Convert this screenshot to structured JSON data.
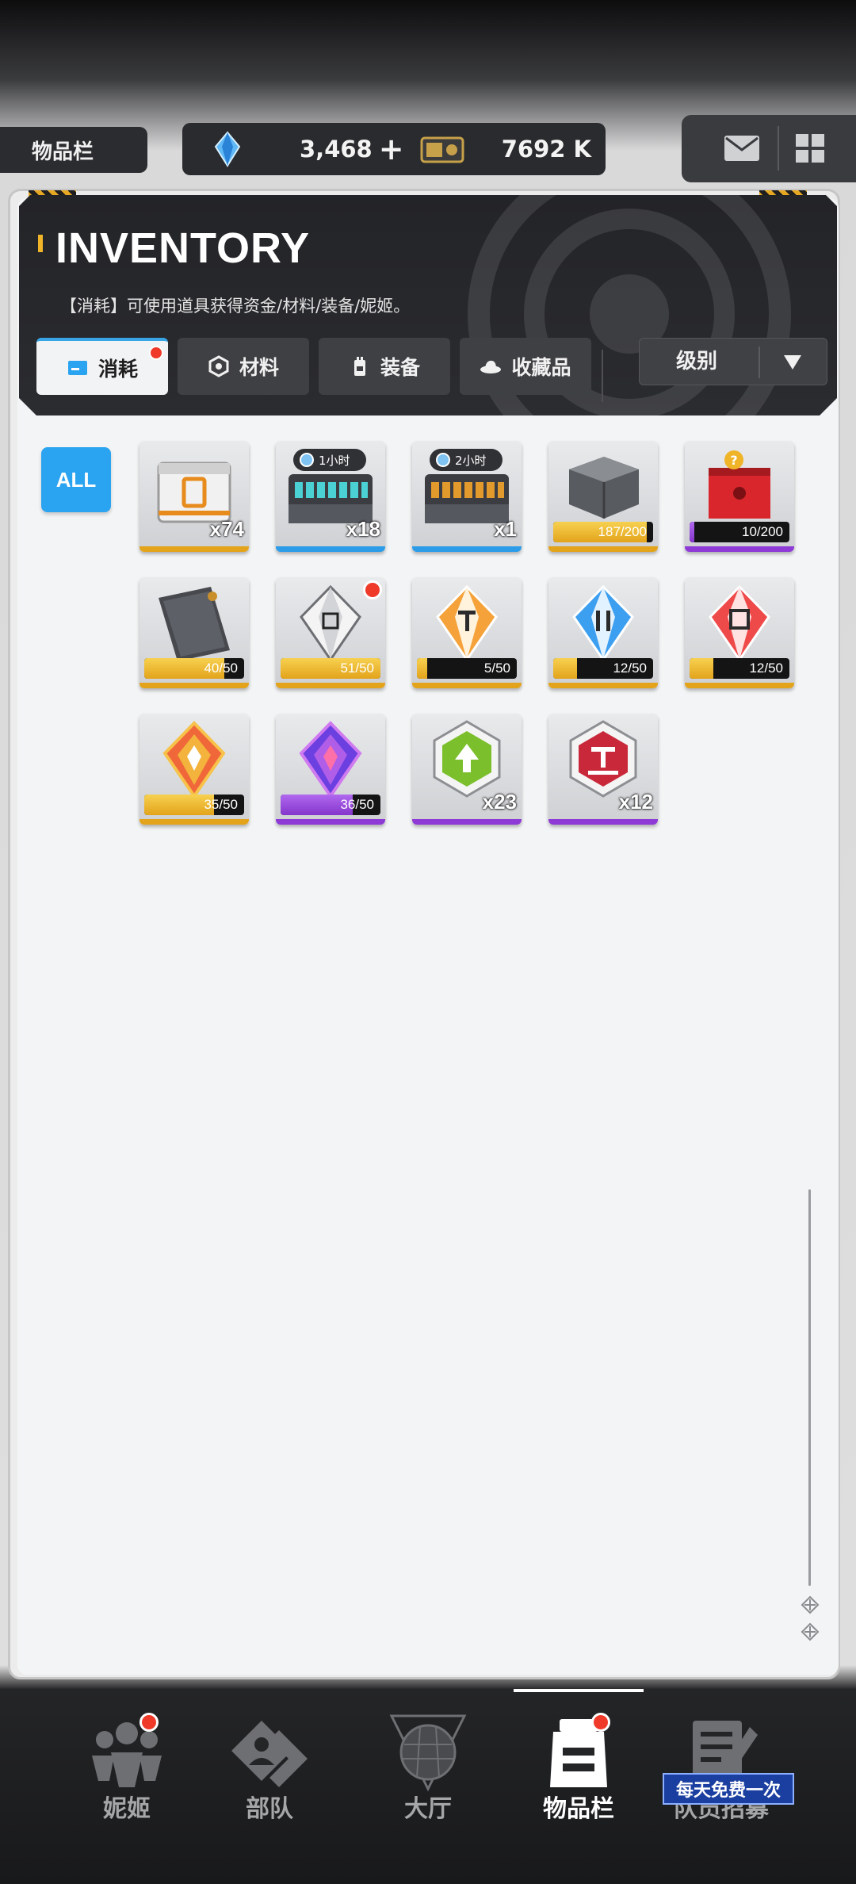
{
  "header": {
    "screen_label": "物品栏",
    "currency": {
      "gems": "3,468",
      "credits": "7692 K"
    }
  },
  "panel": {
    "title": "INVENTORY",
    "description": "【消耗】可使用道具获得资金/材料/装备/妮姬。",
    "tabs": [
      {
        "label": "消耗",
        "active": true,
        "badge": true
      },
      {
        "label": "材料",
        "active": false,
        "badge": false
      },
      {
        "label": "装备",
        "active": false,
        "badge": false
      },
      {
        "label": "收藏品",
        "active": false,
        "badge": false
      }
    ],
    "sort": {
      "selected": "级别"
    }
  },
  "filter": {
    "all_label": "ALL"
  },
  "items": [
    {
      "count": "x74",
      "rarity": "gold"
    },
    {
      "count": "x18",
      "tag": "1小时",
      "rarity": "blue"
    },
    {
      "count": "x1",
      "tag": "2小时",
      "rarity": "blue"
    },
    {
      "progress_text": "187/200",
      "progress": 0.935,
      "rarity": "gold"
    },
    {
      "progress_text": "10/200",
      "progress": 0.05,
      "rarity": "purple"
    },
    {
      "progress_text": "40/50",
      "progress": 0.8,
      "rarity": "gold"
    },
    {
      "progress_text": "51/50",
      "progress": 1.0,
      "rarity": "gold",
      "badge": true
    },
    {
      "progress_text": "5/50",
      "progress": 0.1,
      "rarity": "gold"
    },
    {
      "progress_text": "12/50",
      "progress": 0.24,
      "rarity": "gold"
    },
    {
      "progress_text": "12/50",
      "progress": 0.24,
      "rarity": "gold"
    },
    {
      "progress_text": "35/50",
      "progress": 0.7,
      "rarity": "gold"
    },
    {
      "progress_text": "36/50",
      "progress": 0.72,
      "rarity": "purple"
    },
    {
      "count": "x23",
      "rarity": "purple"
    },
    {
      "count": "x12",
      "rarity": "purple"
    }
  ],
  "bottom_nav": [
    {
      "label": "妮姬",
      "icon": "nikke-icon",
      "badge": true
    },
    {
      "label": "部队",
      "icon": "squad-icon"
    },
    {
      "label": "大厅",
      "icon": "lobby-icon"
    },
    {
      "label": "物品栏",
      "icon": "inventory-icon",
      "active": true,
      "badge": true
    },
    {
      "label": "队员招募",
      "icon": "recruit-icon",
      "promo": "每天免费一次"
    }
  ],
  "colors": {
    "accent_blue": "#2aa3f0",
    "badge_red": "#ef3a2a",
    "rarity_gold": "#e3a31b",
    "rarity_purple": "#8e3ad6"
  }
}
